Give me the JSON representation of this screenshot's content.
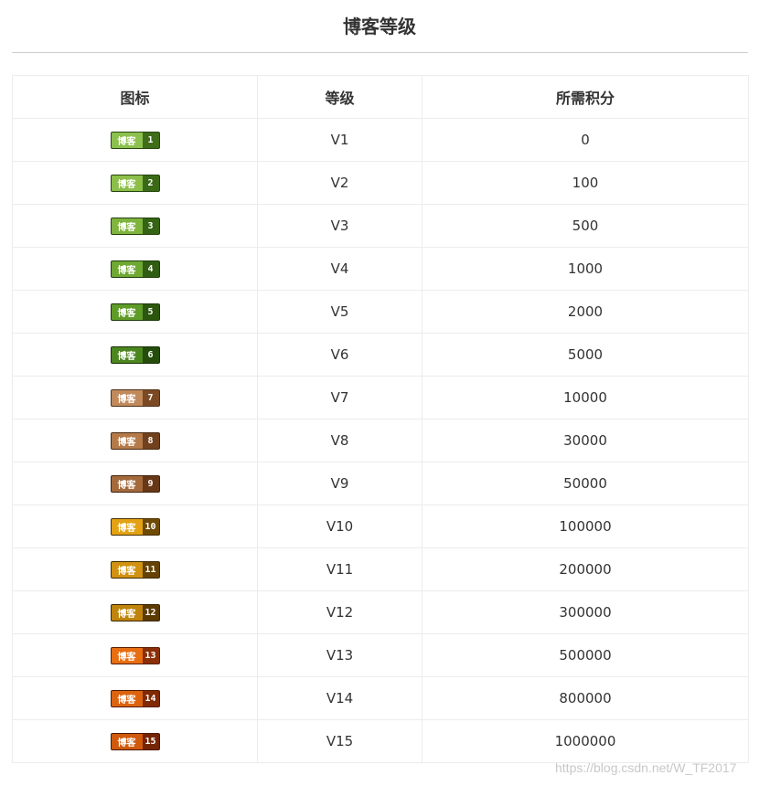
{
  "page": {
    "title": "博客等级"
  },
  "table": {
    "headers": {
      "icon": "图标",
      "level": "等级",
      "points": "所需积分"
    },
    "rows": [
      {
        "badge_text": "博客",
        "badge_num": "1",
        "level": "V1",
        "points": "0",
        "light": "#8dc14f",
        "dark": "#3f6d19"
      },
      {
        "badge_text": "博客",
        "badge_num": "2",
        "level": "V2",
        "points": "100",
        "light": "#8cbf4a",
        "dark": "#3b6a17"
      },
      {
        "badge_text": "博客",
        "badge_num": "3",
        "level": "V3",
        "points": "500",
        "light": "#7fb43e",
        "dark": "#356414"
      },
      {
        "badge_text": "博客",
        "badge_num": "4",
        "level": "V4",
        "points": "1000",
        "light": "#6fa832",
        "dark": "#305d11"
      },
      {
        "badge_text": "博客",
        "badge_num": "5",
        "level": "V5",
        "points": "2000",
        "light": "#5f9b28",
        "dark": "#2b560e"
      },
      {
        "badge_text": "博客",
        "badge_num": "6",
        "level": "V6",
        "points": "5000",
        "light": "#4c861f",
        "dark": "#244c0b"
      },
      {
        "badge_text": "博客",
        "badge_num": "7",
        "level": "V7",
        "points": "10000",
        "light": "#c08a5c",
        "dark": "#7b4a24"
      },
      {
        "badge_text": "博客",
        "badge_num": "8",
        "level": "V8",
        "points": "30000",
        "light": "#b57a4a",
        "dark": "#71401c"
      },
      {
        "badge_text": "博客",
        "badge_num": "9",
        "level": "V9",
        "points": "50000",
        "light": "#a46a3c",
        "dark": "#673716"
      },
      {
        "badge_text": "博客",
        "badge_num": "10",
        "level": "V10",
        "points": "100000",
        "light": "#e3a214",
        "dark": "#6e4a05"
      },
      {
        "badge_text": "博客",
        "badge_num": "11",
        "level": "V11",
        "points": "200000",
        "light": "#d09210",
        "dark": "#654204"
      },
      {
        "badge_text": "博客",
        "badge_num": "12",
        "level": "V12",
        "points": "300000",
        "light": "#bf840c",
        "dark": "#5c3b03"
      },
      {
        "badge_text": "博客",
        "badge_num": "13",
        "level": "V13",
        "points": "500000",
        "light": "#e86e12",
        "dark": "#8a2f06"
      },
      {
        "badge_text": "博客",
        "badge_num": "14",
        "level": "V14",
        "points": "800000",
        "light": "#dc6410",
        "dark": "#802a05"
      },
      {
        "badge_text": "博客",
        "badge_num": "15",
        "level": "V15",
        "points": "1000000",
        "light": "#d05a0e",
        "dark": "#762504"
      }
    ]
  },
  "watermark": "https://blog.csdn.net/W_TF2017"
}
